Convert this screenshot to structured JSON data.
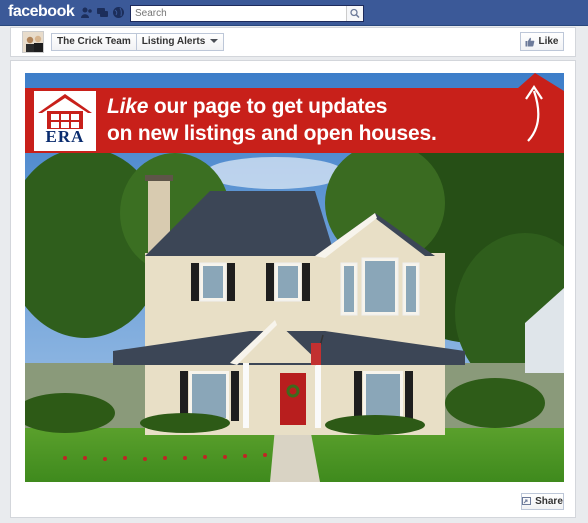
{
  "topbar": {
    "logo": "facebook",
    "search_placeholder": "Search"
  },
  "page_header": {
    "page_name": "The Crick Team",
    "tab_name": "Listing Alerts",
    "like_label": "Like"
  },
  "banner": {
    "line1_em": "Like",
    "line1_rest": " our page to get updates",
    "line2": "on new listings and open houses.",
    "brand": "ERA"
  },
  "footer": {
    "share_label": "Share"
  },
  "colors": {
    "fb_blue": "#3b5998",
    "banner_red": "#c8201a",
    "era_navy": "#0a2c6e"
  }
}
